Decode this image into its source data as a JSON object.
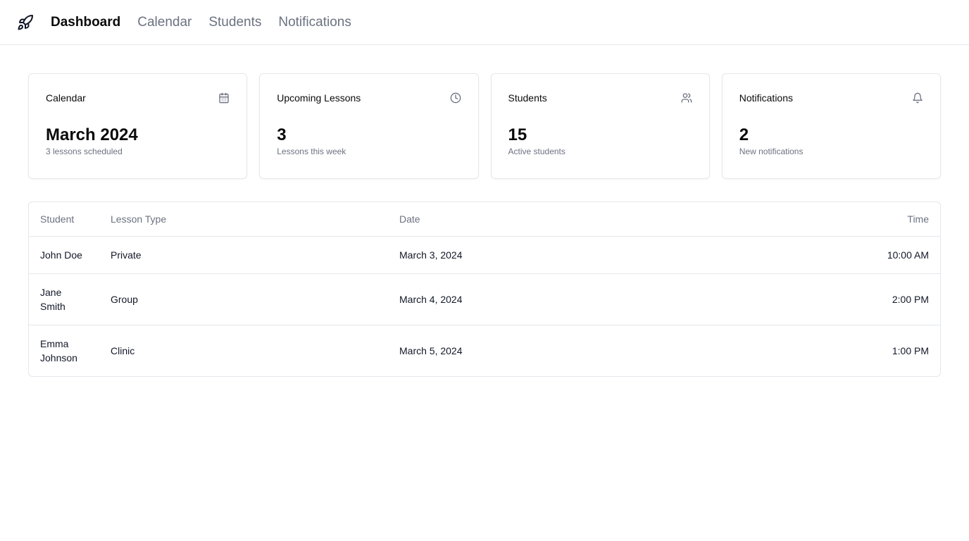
{
  "nav": {
    "logo_icon": "rocket-icon",
    "items": [
      {
        "label": "Dashboard",
        "active": true
      },
      {
        "label": "Calendar",
        "active": false
      },
      {
        "label": "Students",
        "active": false
      },
      {
        "label": "Notifications",
        "active": false
      }
    ]
  },
  "cards": [
    {
      "title": "Calendar",
      "icon": "calendar-icon",
      "value": "March 2024",
      "subtitle": "3 lessons scheduled"
    },
    {
      "title": "Upcoming Lessons",
      "icon": "clock-icon",
      "value": "3",
      "subtitle": "Lessons this week"
    },
    {
      "title": "Students",
      "icon": "users-icon",
      "value": "15",
      "subtitle": "Active students"
    },
    {
      "title": "Notifications",
      "icon": "bell-icon",
      "value": "2",
      "subtitle": "New notifications"
    }
  ],
  "table": {
    "headers": [
      "Student",
      "Lesson Type",
      "Date",
      "Time"
    ],
    "rows": [
      {
        "student": "John Doe",
        "type": "Private",
        "date": "March 3, 2024",
        "time": "10:00 AM"
      },
      {
        "student": "Jane Smith",
        "type": "Group",
        "date": "March 4, 2024",
        "time": "2:00 PM"
      },
      {
        "student": "Emma Johnson",
        "type": "Clinic",
        "date": "March 5, 2024",
        "time": "1:00 PM"
      }
    ]
  }
}
